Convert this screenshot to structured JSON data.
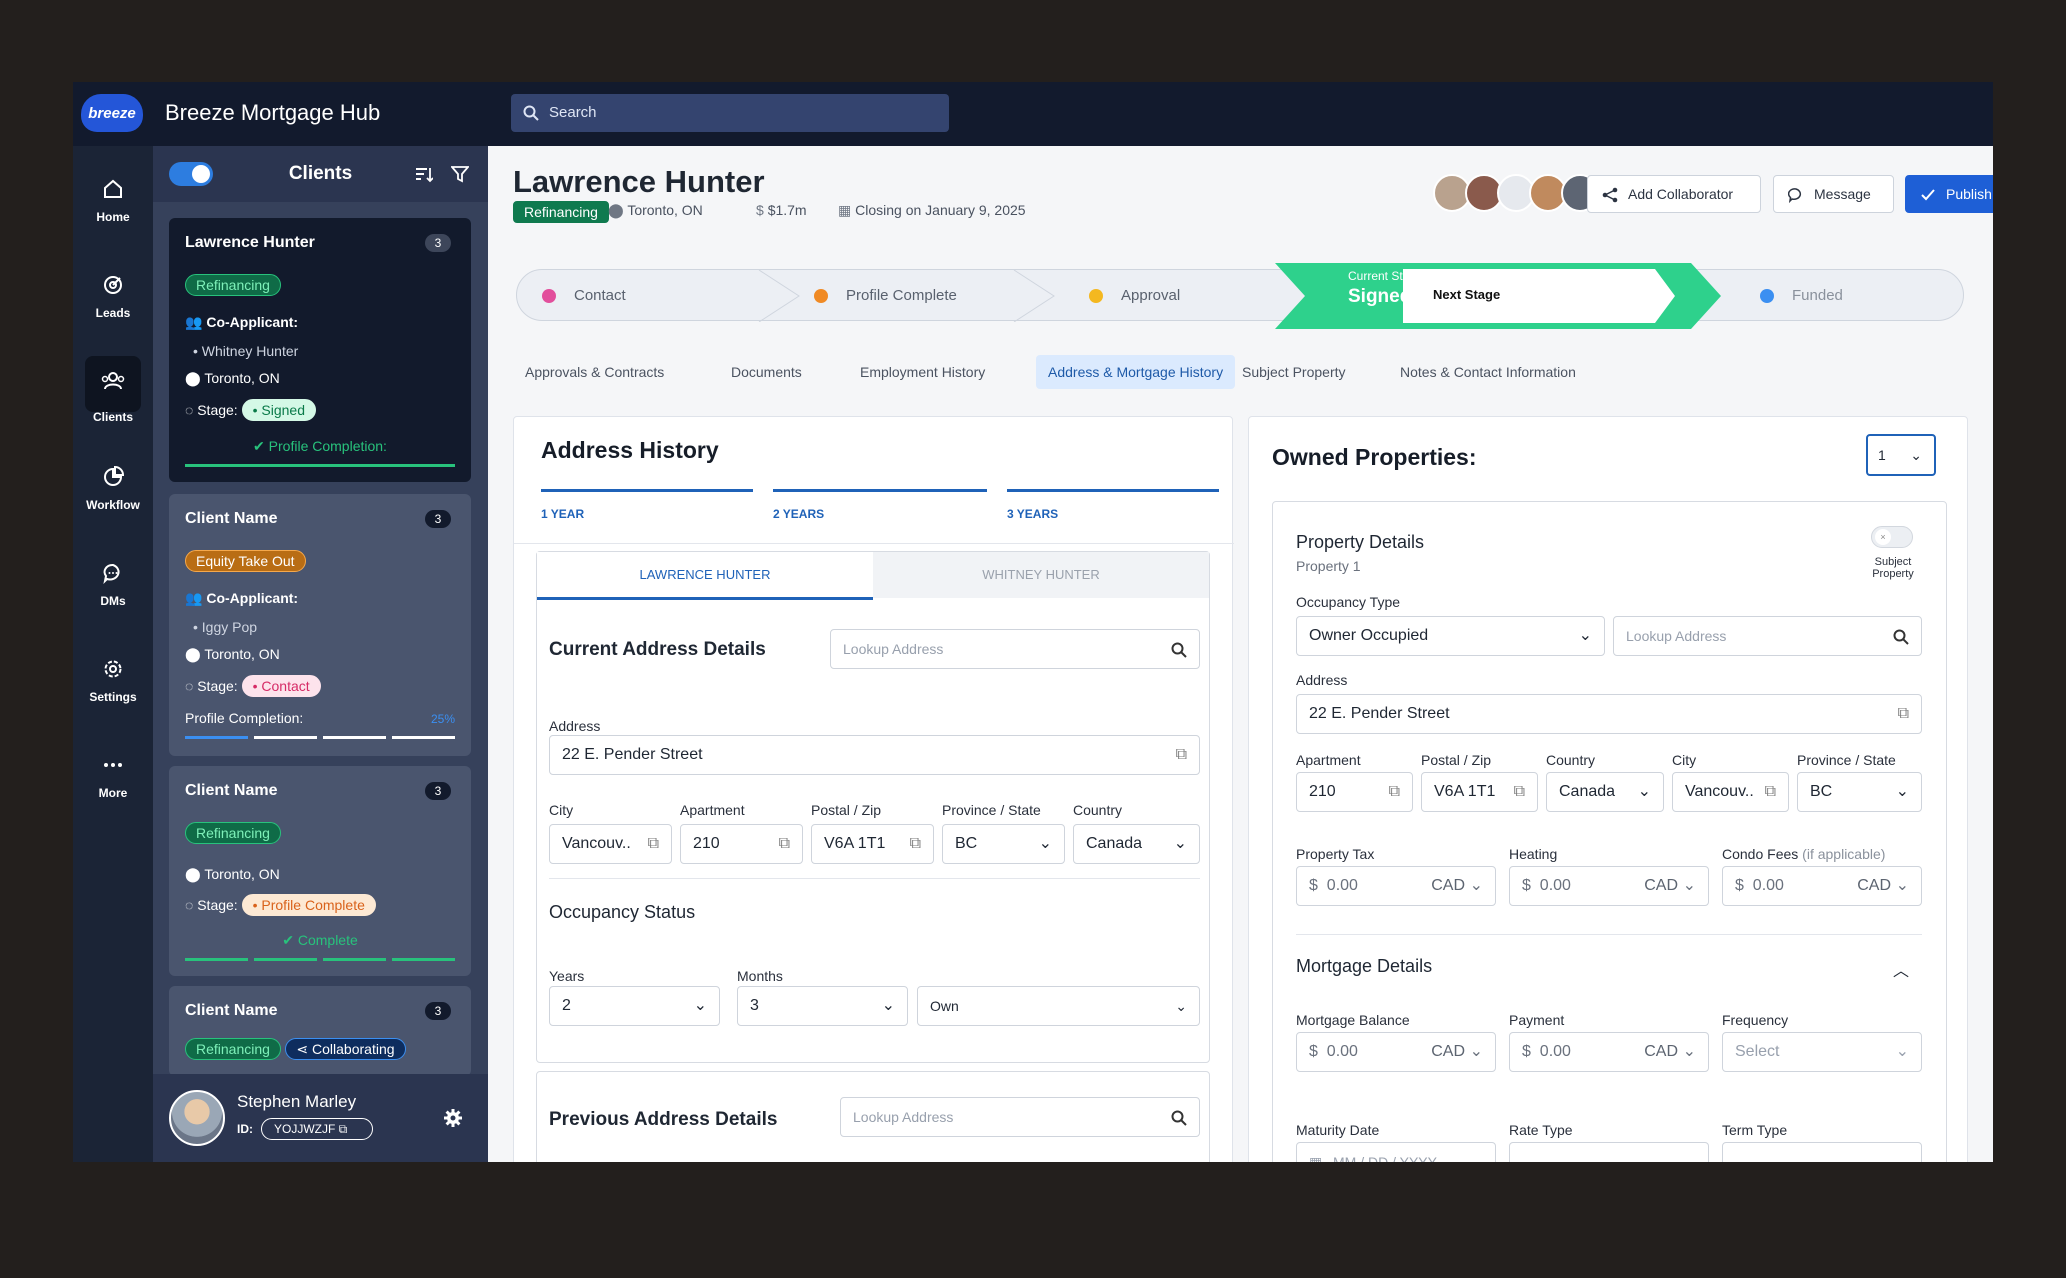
{
  "app": {
    "logo_text": "breeze",
    "title": "Breeze Mortgage Hub",
    "search_placeholder": "Search"
  },
  "rail": [
    {
      "label": "Home",
      "icon": "home-icon"
    },
    {
      "label": "Leads",
      "icon": "target-icon"
    },
    {
      "label": "Clients",
      "icon": "users-icon"
    },
    {
      "label": "Workflow",
      "icon": "pie-chart-icon"
    },
    {
      "label": "DMs",
      "icon": "chat-icon"
    },
    {
      "label": "Settings",
      "icon": "gear-icon"
    },
    {
      "label": "More",
      "icon": "more-icon"
    }
  ],
  "clients": {
    "title": "Clients",
    "cards": [
      {
        "name": "Lawrence Hunter",
        "count": "3",
        "tag": "Refinancing",
        "coapp_label": "Co-Applicant:",
        "coapp": "Whitney Hunter",
        "location": "Toronto, ON",
        "stage_label": "Stage:",
        "stage": "Signed",
        "progress_label": "Profile Completion:"
      },
      {
        "name": "Client Name",
        "count": "3",
        "tag": "Equity Take Out",
        "coapp_label": "Co-Applicant:",
        "coapp": "Iggy Pop",
        "location": "Toronto, ON",
        "stage_label": "Stage:",
        "stage": "Contact",
        "progress_label": "Profile Completion:",
        "progress_value": "25%"
      },
      {
        "name": "Client Name",
        "count": "3",
        "tag": "Refinancing",
        "location": "Toronto, ON",
        "stage_label": "Stage:",
        "stage": "Profile Complete",
        "progress_label": "Complete"
      },
      {
        "name": "Client Name",
        "count": "3",
        "tag": "Refinancing",
        "tag2": "Collaborating"
      }
    ],
    "user": {
      "name": "Stephen Marley",
      "id_label": "ID:",
      "id": "YOJJWZJF"
    }
  },
  "header": {
    "name": "Lawrence Hunter",
    "tag": "Refinancing",
    "location": "Toronto, ON",
    "amount": "$1.7m",
    "closing": "Closing on January 9, 2025",
    "add_collaborator": "Add Collaborator",
    "message": "Message",
    "publish": "Publish"
  },
  "stages": {
    "contact": "Contact",
    "profile": "Profile Complete",
    "approval": "Approval",
    "current_label": "Current Stage",
    "current": "Signed",
    "next": "Next Stage",
    "funded": "Funded"
  },
  "tabs": [
    "Approvals & Contracts",
    "Documents",
    "Employment History",
    "Address & Mortgage History",
    "Subject Property",
    "Notes & Contact Information"
  ],
  "address": {
    "title": "Address History",
    "years": [
      "1 YEAR",
      "2 YEARS",
      "3 YEARS"
    ],
    "applicants": [
      "LAWRENCE HUNTER",
      "WHITNEY HUNTER"
    ],
    "current_title": "Current Address Details",
    "lookup": "Lookup Address",
    "address_label": "Address",
    "address": "22 E. Pender Street",
    "city_label": "City",
    "city": "Vancouv..",
    "apt_label": "Apartment",
    "apt": "210",
    "postal_label": "Postal / Zip",
    "postal": "V6A 1T1",
    "prov_label": "Province / State",
    "prov": "BC",
    "country_label": "Country",
    "country": "Canada",
    "occ_title": "Occupancy Status",
    "years_label": "Years",
    "years_val": "2",
    "months_label": "Months",
    "months_val": "3",
    "own": "Own",
    "prev_title": "Previous Address Details"
  },
  "owned": {
    "title": "Owned Properties:",
    "count": "1",
    "details_title": "Property Details",
    "property_sub": "Property 1",
    "subject_label": "Subject Property",
    "occ_label": "Occupancy Type",
    "occ": "Owner Occupied",
    "lookup": "Lookup Address",
    "address_label": "Address",
    "address": "22 E. Pender Street",
    "apt_label": "Apartment",
    "apt": "210",
    "postal_label": "Postal / Zip",
    "postal": "V6A 1T1",
    "country_label": "Country",
    "country": "Canada",
    "city_label": "City",
    "city": "Vancouv..",
    "prov_label": "Province / State",
    "prov": "BC",
    "tax_label": "Property Tax",
    "heat_label": "Heating",
    "condo_label": "Condo Fees",
    "condo_note": "(if applicable)",
    "money": "0.00",
    "currency": "CAD",
    "dollar": "$",
    "mort_title": "Mortgage Details",
    "bal_label": "Mortgage Balance",
    "pay_label": "Payment",
    "freq_label": "Frequency",
    "freq": "Select",
    "mat_label": "Maturity Date",
    "mat_ph": "MM / DD / YYYY",
    "rate_label": "Rate Type",
    "term_label": "Term Type"
  }
}
